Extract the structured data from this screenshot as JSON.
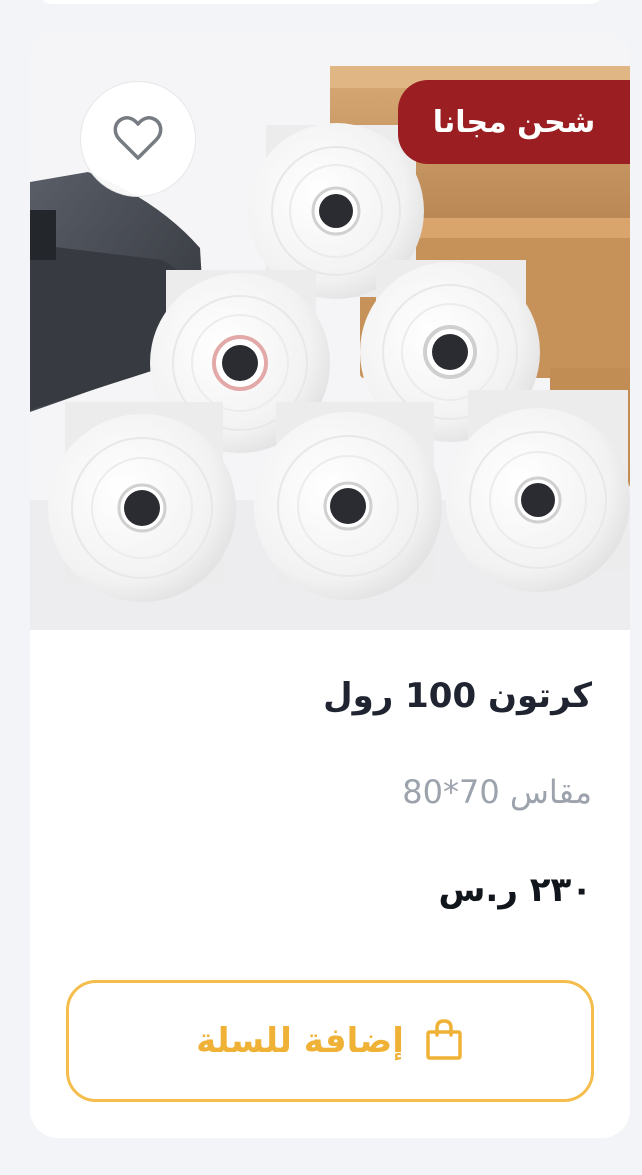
{
  "product": {
    "badge": "شحن مجانا",
    "title": "كرتون 100 رول",
    "subtitle": "مقاس 70*80",
    "price": "٢٣٠ ر.س",
    "add_to_cart_label": "إضافة للسلة",
    "image_alt": "thermal paper rolls"
  },
  "icons": {
    "favorite": "heart-icon",
    "cart": "shopping-bag-icon"
  },
  "colors": {
    "page_background": "#f3f4f8",
    "card_background": "#ffffff",
    "badge_background": "#9b1f22",
    "badge_text": "#ffffff",
    "accent": "#f0b236",
    "title_text": "#1f2430",
    "subtitle_text": "#9ca3ad",
    "price_text": "#11151c"
  }
}
